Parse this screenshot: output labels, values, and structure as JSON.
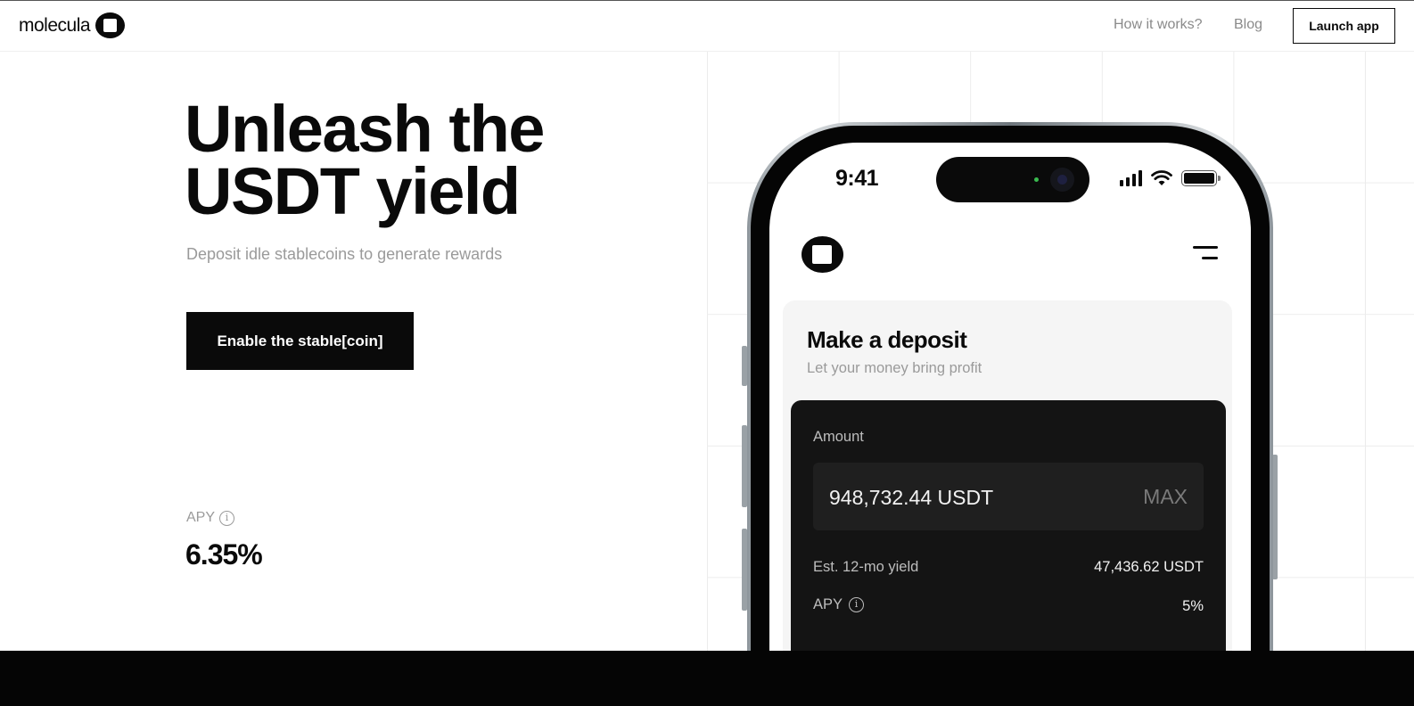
{
  "header": {
    "brand": "molecula",
    "nav": {
      "how_it_works": "How it works?",
      "blog": "Blog"
    },
    "launch_app": "Launch app"
  },
  "hero": {
    "title_line1": "Unleash the",
    "title_line2": "USDT yield",
    "subtitle": "Deposit idle stablecoins to generate rewards",
    "cta": "Enable the stable[coin]",
    "apy_label": "APY",
    "apy_value": "6.35%"
  },
  "phone": {
    "status_time": "9:41",
    "deposit": {
      "title": "Make a deposit",
      "subtitle": "Let your money bring profit",
      "amount_label": "Amount",
      "amount_value": "948,732.44 USDT",
      "max_label": "MAX",
      "yield_label": "Est. 12-mo yield",
      "yield_value": "47,436.62 USDT",
      "apy_label": "APY",
      "apy_value": "5%"
    }
  },
  "icons": {
    "brand": "molecula-logo-icon",
    "info": "info-icon",
    "menu": "hamburger-menu-icon",
    "signal": "cellular-signal-icon",
    "wifi": "wifi-icon",
    "battery": "battery-icon"
  },
  "colors": {
    "primary": "#0a0a0a",
    "muted": "#9a9a9a",
    "panel_dark": "#141414",
    "card_light": "#f5f5f5"
  }
}
